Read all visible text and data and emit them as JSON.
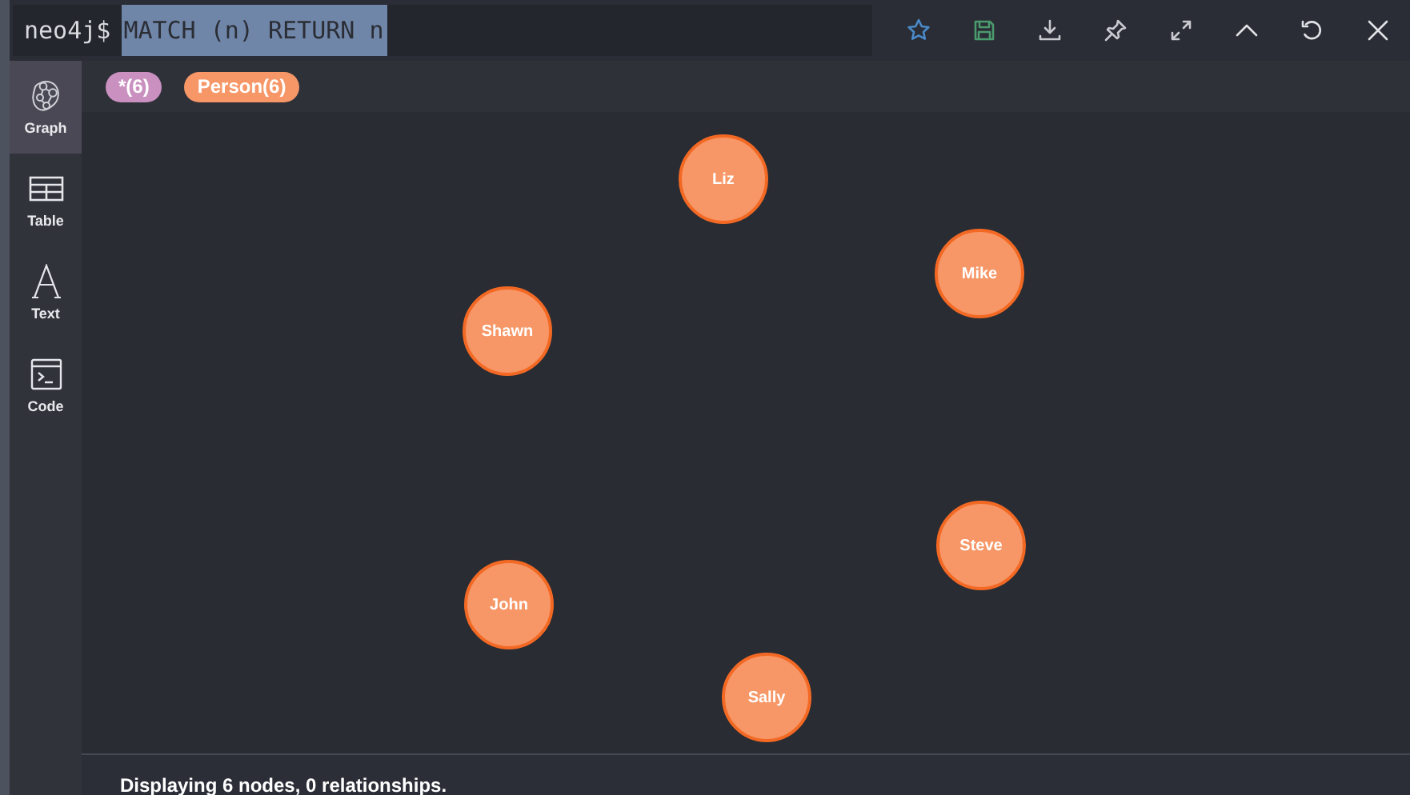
{
  "editor": {
    "prompt": "neo4j$",
    "query": "MATCH (n) RETURN n",
    "query_selected": true
  },
  "sidebar": {
    "items": [
      {
        "label": "Graph",
        "kind": "graph",
        "selected": true
      },
      {
        "label": "Table",
        "kind": "table",
        "selected": false
      },
      {
        "label": "Text",
        "kind": "text",
        "selected": false
      },
      {
        "label": "Code",
        "kind": "code",
        "selected": false
      }
    ]
  },
  "labels": [
    {
      "text": "*(6)",
      "color": "#c990c0"
    },
    {
      "text": "Person(6)",
      "color": "#f79767"
    }
  ],
  "nodes": [
    {
      "caption": "Liz"
    },
    {
      "caption": "Mike"
    },
    {
      "caption": "Shawn"
    },
    {
      "caption": "Steve"
    },
    {
      "caption": "John"
    },
    {
      "caption": "Sally"
    }
  ],
  "status_bar": "Displaying 6 nodes, 0 relationships."
}
